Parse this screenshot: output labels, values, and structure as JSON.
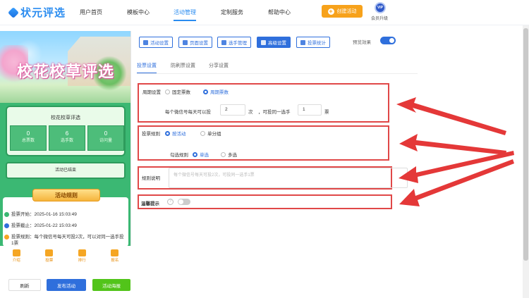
{
  "brand": {
    "name": "状元评选"
  },
  "nav": [
    {
      "label": "用户首页"
    },
    {
      "label": "模板中心"
    },
    {
      "label": "活动管理",
      "active": true
    },
    {
      "label": "定制服务"
    },
    {
      "label": "帮助中心"
    }
  ],
  "header": {
    "create_label": "创建活动",
    "vip_badge": "VIP",
    "vip_label": "会员升级"
  },
  "preview": {
    "banner_title": "校花校草评选",
    "card_title": "校花校草评选",
    "stats": [
      {
        "value": "0",
        "label": "总票数"
      },
      {
        "value": "6",
        "label": "选手数"
      },
      {
        "value": "0",
        "label": "访问量"
      }
    ],
    "ended": "活动已结束",
    "rules_title": "活动规则",
    "rules": [
      {
        "text": "投票开始：2025-01-16 15:03:49",
        "color": "#3bb873"
      },
      {
        "text": "投票截止：2025-01-22 15:03:49",
        "color": "#2f6fdc"
      },
      {
        "text": "投票规则：每个微信号每天可投2次，可以对同一选手投1票",
        "color": "#f5a623"
      }
    ],
    "tabbar": [
      "介绍",
      "投票",
      "排行",
      "报名"
    ]
  },
  "bottom_buttons": {
    "refresh": "刷新",
    "publish": "发布活动",
    "poster": "活动海报"
  },
  "settings": {
    "toolbar": [
      "活动设置",
      "页面设置",
      "选手管理",
      "高级设置",
      "投票统计"
    ],
    "active_tool": "高级设置",
    "preview_label": "预览效果",
    "subtabs": [
      "投票设置",
      "防刷票设置",
      "分享设置"
    ],
    "period_label": "周期设置",
    "period_options": [
      "固定票数",
      "周期票数"
    ],
    "period_selected": "周期票数",
    "per_day_prefix": "每个微信号每天可以投",
    "per_day_value": "2",
    "per_day_unit": "次",
    "per_player_prefix": "，可投同一选手",
    "per_player_value": "1",
    "per_player_unit": "票",
    "vote_rule_label": "投票规则",
    "vote_rule_options": [
      "按活动",
      "单分组"
    ],
    "vote_rule_selected": "按活动",
    "check_rule_label": "勾选规则",
    "check_rule_options": [
      "单选",
      "多选"
    ],
    "check_rule_selected": "单选",
    "rule_desc_label": "规则说明",
    "rule_desc_placeholder": "每个微信号每天可投2次，可投同一选手1票",
    "warm_tip_label": "温馨提示",
    "warm_tip_help": "?"
  }
}
